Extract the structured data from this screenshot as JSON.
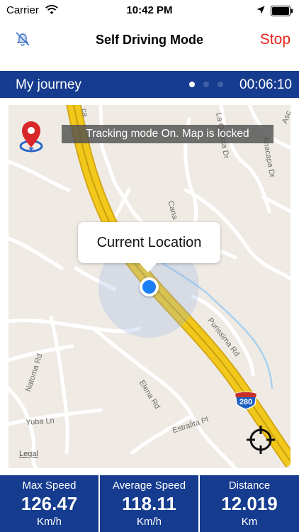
{
  "status_bar": {
    "carrier": "Carrier",
    "time": "10:42 PM",
    "icons": [
      "wifi-icon",
      "location-arrow-icon",
      "battery-icon"
    ]
  },
  "nav": {
    "title": "Self Driving Mode",
    "stop_label": "Stop",
    "left_icon": "mute-bell-icon"
  },
  "journey": {
    "label": "My journey",
    "pages": 3,
    "active_page": 1,
    "timer": "00:06:10"
  },
  "map": {
    "tracking_message": "Tracking mode On. Map is locked",
    "callout": "Current Location",
    "legal": "Legal",
    "highway_shield": "280",
    "streets": {
      "canada": "Cana",
      "la_questa": "La Questa Dr",
      "anacapa": "Anacapa Dr",
      "asc": "Asc",
      "purissima": "Purissima Rd",
      "natoma": "Natoma Rd",
      "elena": "Elena Rd",
      "yuba": "Yuba Ln",
      "estralita": "Estralita Pl",
      "ca_fragment": "ca"
    }
  },
  "stats": [
    {
      "label": "Max Speed",
      "value": "126.47",
      "unit": "Km/h"
    },
    {
      "label": "Average Speed",
      "value": "118.11",
      "unit": "Km/h"
    },
    {
      "label": "Distance",
      "value": "12.019",
      "unit": "Km"
    }
  ],
  "colors": {
    "brand_blue": "#163c8f",
    "stop_red": "#e8261c",
    "location_blue": "#1a7ff4",
    "highway_yellow": "#f2c81a"
  }
}
